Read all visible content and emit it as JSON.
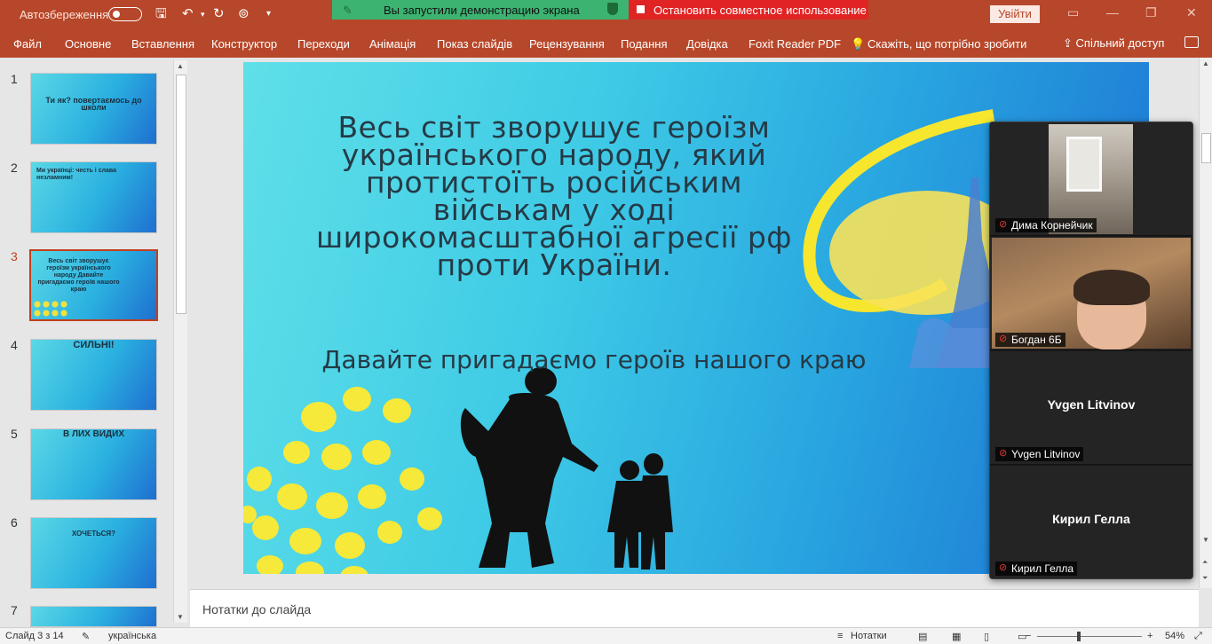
{
  "titlebar": {
    "autosave_label": "Автозбереження",
    "share_banner": "Вы запустили демонстрацию экрана",
    "stop_sharing": "Остановить совместное использование",
    "signin_label": "Увійти",
    "colors": {
      "accent": "#b7472a",
      "share_green": "#3cb371",
      "stop_red": "#e02424"
    }
  },
  "menu": {
    "items": [
      "Файл",
      "Основне",
      "Вставлення",
      "Конструктор",
      "Переходи",
      "Анімація",
      "Показ слайдів",
      "Рецензування",
      "Подання",
      "Довідка",
      "Foxit Reader PDF"
    ],
    "tell_me": "Скажіть, що потрібно зробити",
    "share": "Спільний доступ"
  },
  "thumbnails": [
    {
      "num": "1",
      "text": "Ти як? повертаємось до школи"
    },
    {
      "num": "2",
      "text": "Ми українці: честь і слава незламним!"
    },
    {
      "num": "3",
      "text": "Весь світ зворушує героїзм українського народу Давайте пригадаємо героїв нашого краю"
    },
    {
      "num": "4",
      "text": "СИЛЬНІ!"
    },
    {
      "num": "5",
      "text": "В ЛИХ ВИДИХ"
    },
    {
      "num": "6",
      "text": "ХОЧЕТЬСЯ?"
    },
    {
      "num": "7",
      "text": ""
    }
  ],
  "slide": {
    "title": "Весь світ зворушує героїзм українського народу, який протистоїть російським військам у ході широкомасштабної агресії рф проти України.",
    "subtitle": "Давайте пригадаємо героїв нашого краю"
  },
  "notes": {
    "placeholder": "Нотатки до слайда"
  },
  "status": {
    "slide_counter": "Слайд 3 з 14",
    "language": "українська",
    "notes_btn": "Нотатки",
    "zoom": "54%"
  },
  "video": {
    "participants": [
      {
        "name": "Дима Корнейчик",
        "video": true
      },
      {
        "name": "Богдан 6Б",
        "video": true
      },
      {
        "name": "Yvgen Litvinov",
        "video": false,
        "center": "Yvgen Litvinov"
      },
      {
        "name": "Кирил Гелла",
        "video": false,
        "center": "Кирил Гелла"
      }
    ]
  }
}
